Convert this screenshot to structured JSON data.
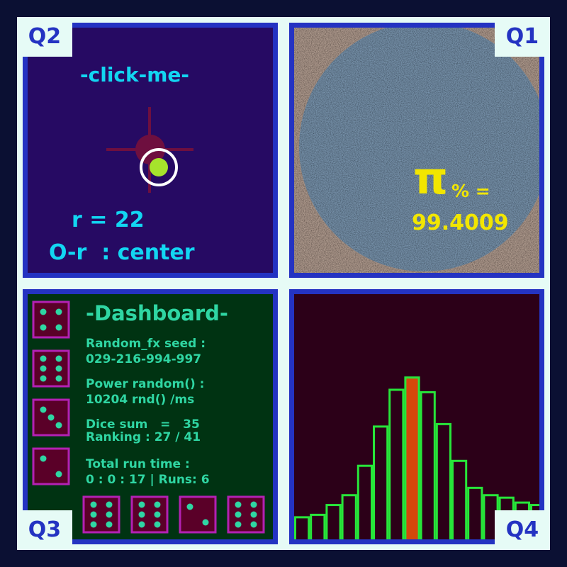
{
  "quadrants": {
    "q1": "Q1",
    "q2": "Q2",
    "q3": "Q3",
    "q4": "Q4"
  },
  "q2": {
    "title": "-click-me-",
    "radius_text": "r = 22",
    "mode_text": "O-r  : center"
  },
  "q1": {
    "pi_symbol": "π",
    "pi_suffix": "% =",
    "value": "99.4009"
  },
  "q3": {
    "title": "-Dashboard-",
    "seed_label": "Random_fx seed :",
    "seed_value": "029-216-994-997",
    "power_label": "Power random() :",
    "power_value": "10204 rnd() /ms",
    "dice_sum": "Dice sum   =   35",
    "ranking": "Ranking : 27 / 41",
    "runtime_label": "Total run time :",
    "runtime_value": "0 : 0 : 17 | Runs: 6",
    "left_dice": [
      4,
      6,
      3,
      2
    ],
    "bottom_dice": [
      6,
      6,
      2,
      6
    ]
  },
  "chart_data": {
    "type": "bar",
    "values": [
      0.09,
      0.1,
      0.14,
      0.18,
      0.3,
      0.46,
      0.61,
      0.66,
      0.6,
      0.47,
      0.32,
      0.21,
      0.18,
      0.17,
      0.15,
      0.14
    ],
    "highlight_index": 7,
    "bar_color": "#27e63a",
    "highlight_color": "#d4480b"
  },
  "colors": {
    "border": "#2433c2",
    "accent_cyan": "#12d6f2",
    "pi_yellow": "#f2e600",
    "dice_border": "#b321b3",
    "pip": "#2fd6a3"
  }
}
